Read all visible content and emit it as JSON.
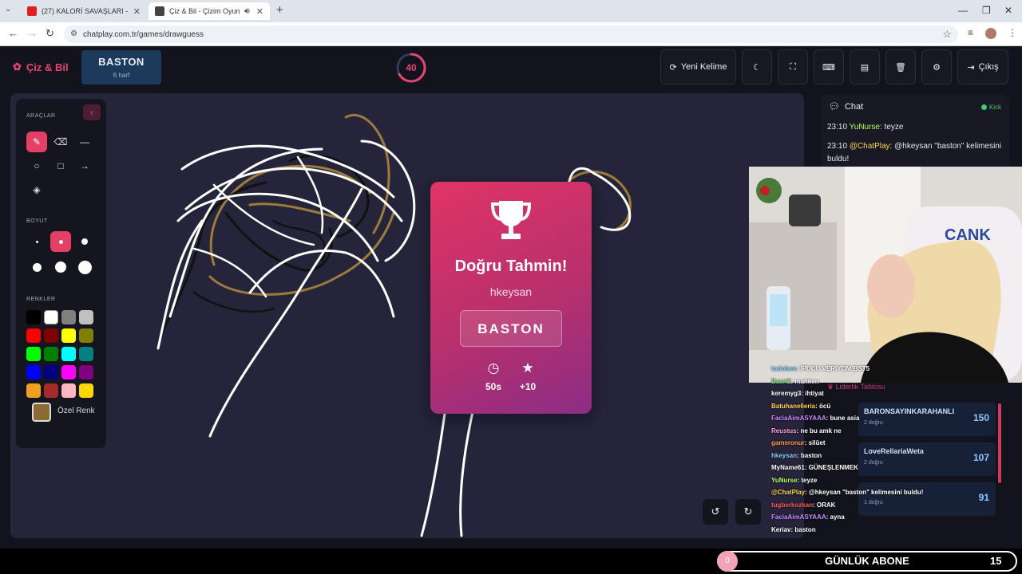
{
  "browser": {
    "tabs": [
      {
        "title": "(27) KALORİ SAVAŞLARI - YouT",
        "favicon_color": "#e02020"
      },
      {
        "title": "Çiz & Bil - Çizim Oyunu",
        "favicon_color": "#444444"
      }
    ],
    "url": "chatplay.com.tr/games/drawguess"
  },
  "header": {
    "logo": "Çiz & Bil",
    "word": "BASTON",
    "word_letters": "6 harf",
    "timer": "40",
    "timer_fraction": 0.67,
    "new_word_label": "Yeni Kelime",
    "exit_label": "Çıkış"
  },
  "tools": {
    "tools_label": "ARAÇLAR",
    "size_label": "BOYUT",
    "colors_label": "RENKLER",
    "custom_color_label": "Özel Renk",
    "custom_color": "#8b6b33",
    "palette": [
      "#000000",
      "#ffffff",
      "#808080",
      "#c0c0c0",
      "#ff0000",
      "#800000",
      "#ffff00",
      "#808000",
      "#00ff00",
      "#008000",
      "#00ffff",
      "#008080",
      "#0000ff",
      "#000080",
      "#ff00ff",
      "#800080",
      "#f0a020",
      "#a52a2a",
      "#ffb6c1",
      "#ffd700"
    ]
  },
  "result": {
    "title": "Doğru Tahmin!",
    "user": "hkeysan",
    "word": "BASTON",
    "time": "50s",
    "points": "+10"
  },
  "chat": {
    "title": "Chat",
    "status": "Kick",
    "messages": [
      {
        "time": "23:10",
        "user": "YuNurse",
        "text": ": teyze"
      },
      {
        "time": "23:10",
        "user": "@ChatPlay",
        "text": ": @hkeysan \"baston\" kelimesini buldu!"
      }
    ]
  },
  "overlay": {
    "leaderboard_title": "Liderlik Tablosu",
    "leaderboard": [
      {
        "name": "BARONSAYINKARAHANLI",
        "sub": "2 doğru",
        "score": "150"
      },
      {
        "name": "LoveRellariaWeta",
        "sub": "2 doğru",
        "score": "107"
      },
      {
        "name": "",
        "sub": "1 doğru",
        "score": "91"
      }
    ],
    "messages": [
      {
        "user": "tudoben",
        "text": ": İPUCU VERİYOM BST5",
        "color": "#7fd0ff"
      },
      {
        "user": "Basri2",
        "text": ": manken",
        "color": "#7ddc7d"
      },
      {
        "user": "keremyg3",
        "text": ": ihtiyat",
        "color": "#ffffff"
      },
      {
        "user": "Batuhane6eria",
        "text": ": öcü",
        "color": "#ffd24a"
      },
      {
        "user": "FaciaAimASYAAA",
        "text": ": bune asia",
        "color": "#c98bff"
      },
      {
        "user": "Reustus",
        "text": ": ne bu amk ne",
        "color": "#ff9de0"
      },
      {
        "user": "gameronur",
        "text": ": silüet",
        "color": "#ff9a3c"
      },
      {
        "user": "hkeysan",
        "text": ": baston",
        "color": "#8fd0ff"
      },
      {
        "user": "MyName61",
        "text": ": GÜNEŞLENMEK",
        "color": "#ffffff"
      },
      {
        "user": "YuNurse",
        "text": ": teyze",
        "color": "#b7ff5a"
      },
      {
        "user": "@ChatPlay",
        "text": ": @hkeysan \"baston\" kelimesini buldu!",
        "color": "#ffd24a"
      },
      {
        "user": "tugberkozkan",
        "text": ": ORAK",
        "color": "#ff5a5a"
      },
      {
        "user": "FaciaAimASYAAA",
        "text": ": ayna",
        "color": "#c98bff"
      },
      {
        "user": "Keriav",
        "text": ": baston",
        "color": "#ffffff"
      }
    ]
  },
  "stream": {
    "subscriber_label": "GÜNLÜK ABONE",
    "subscriber_count": "15",
    "subscriber_progress": "0"
  }
}
